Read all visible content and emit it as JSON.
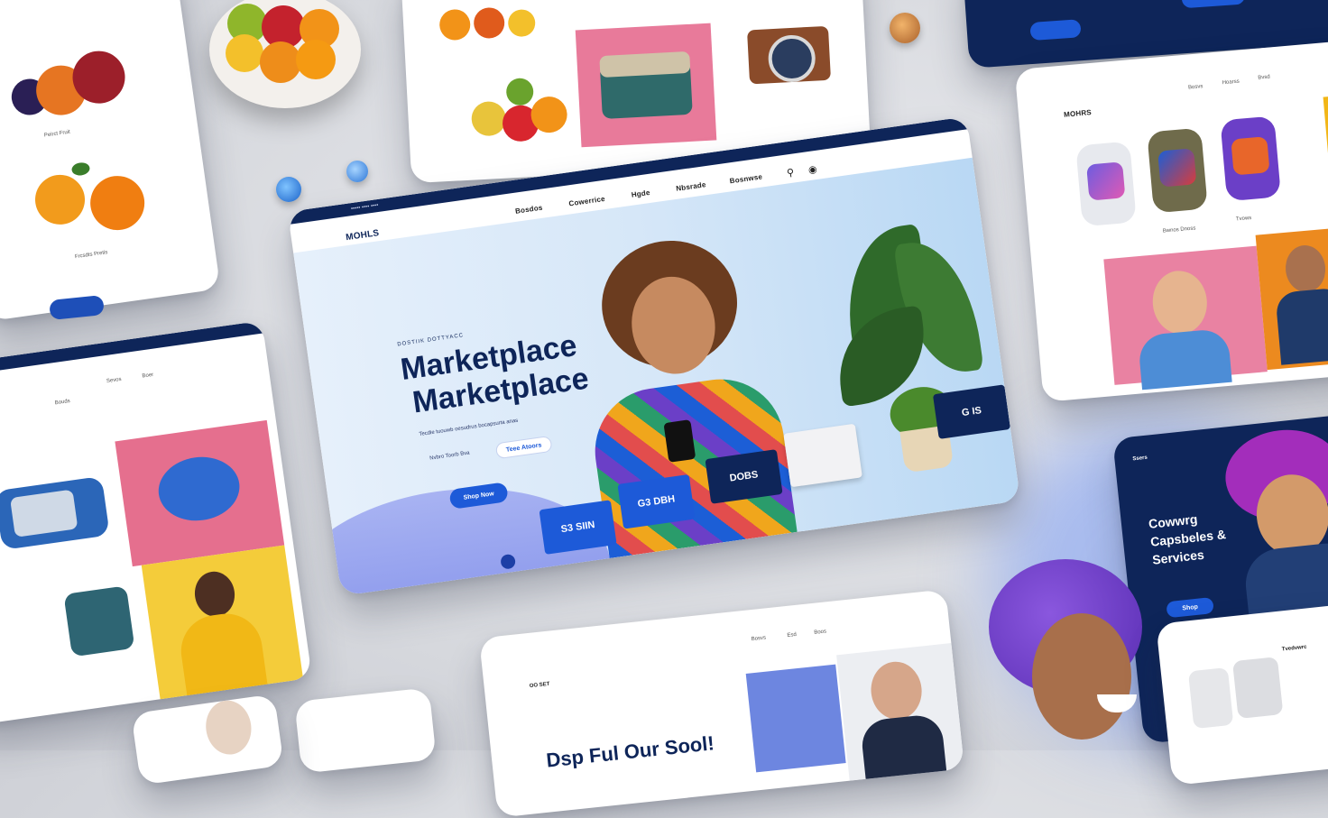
{
  "hero": {
    "nav_top": "•••••  ••••  ••••",
    "logo": "MOHLS",
    "nav": [
      "Bosdos",
      "Cowerrice",
      "Hgde",
      "Nbsrade",
      "Bosnwse"
    ],
    "eyebrow": "DOSTIIK  DOTTYACC",
    "title_1": "Marketplace",
    "title_2": "Marketplace",
    "subtitle": "Tecdie tuouwb oesudrus bocapsurta anas",
    "link_1": "Nvbro Toorb Bva",
    "link_2": "Teee Atoors",
    "cta": "Shop Now",
    "promo_1": "S3 SIIN",
    "promo_2": "G3 DBH",
    "promo_3": "DOBS",
    "promo_4": "G IS"
  },
  "watches_card": {
    "logo": "MOHRS",
    "nav": [
      "Bosvs",
      "Hoarss",
      "Bvsd"
    ],
    "caption_1": "Bwnos Dnoss",
    "caption_2": "Tvows"
  },
  "services_card": {
    "brand": "Ssers",
    "title_1": "Cowwrg",
    "title_2": "Capsbeles &",
    "title_3": "Services",
    "cta": "Shop"
  },
  "bottom_card": {
    "logo": "OO SET",
    "headline": "Dsp Ful Our Sool!",
    "nav": [
      "Bosvs",
      "Esd",
      "Boos"
    ]
  },
  "left_card": {
    "nav": [
      "Bouds",
      "Sevos",
      "Boer"
    ]
  },
  "fruit_card": {
    "caption_1": "Peirct Fruit",
    "caption_2": "Frcsdts Pretis"
  },
  "right_bottom_card": {
    "title": "Tvedvwrc"
  },
  "colors": {
    "navy": "#0e2559",
    "blue": "#1d5ad8",
    "pink": "#e56f8e",
    "yellow": "#f4cc3a",
    "orange": "#ec8a1f",
    "purple": "#7f4fd0"
  }
}
